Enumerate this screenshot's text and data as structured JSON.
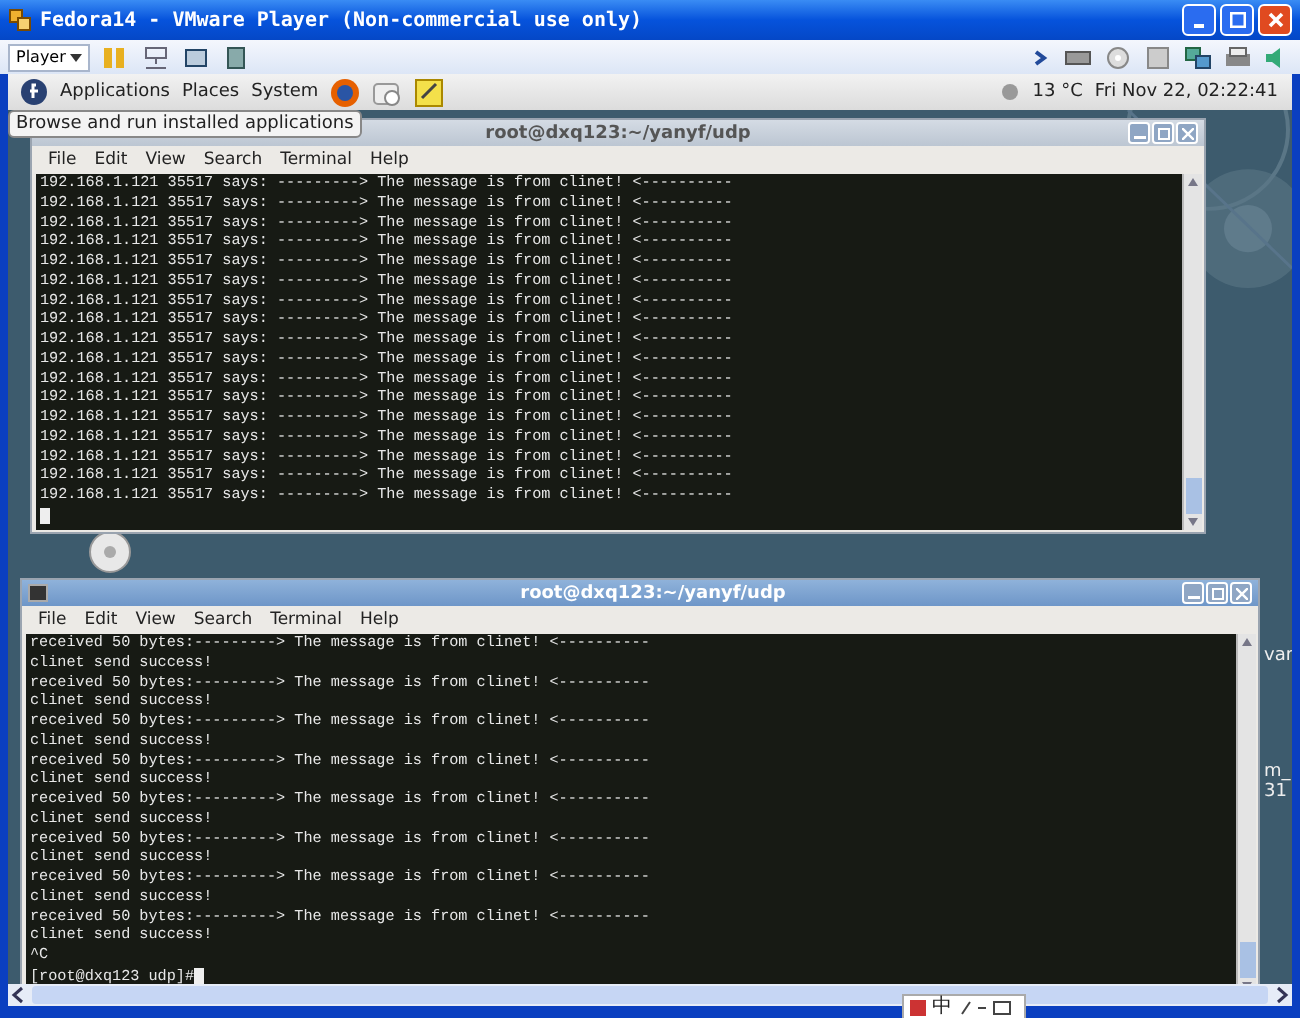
{
  "window": {
    "title": "Fedora14 - VMware Player (Non-commercial use only)"
  },
  "toolbar": {
    "player_label": "Player"
  },
  "panel": {
    "menus": [
      "Applications",
      "Places",
      "System"
    ],
    "weather": "13 °C",
    "clock": "Fri Nov 22, 02:22:41"
  },
  "tooltip": "Browse and run installed applications",
  "terminals": [
    {
      "title": "root@dxq123:~/yanyf/udp",
      "menus": [
        "File",
        "Edit",
        "View",
        "Search",
        "Terminal",
        "Help"
      ],
      "lines": [
        "192.168.1.121 35517 says: ---------> The message is from clinet! <----------",
        "192.168.1.121 35517 says: ---------> The message is from clinet! <----------",
        "192.168.1.121 35517 says: ---------> The message is from clinet! <----------",
        "192.168.1.121 35517 says: ---------> The message is from clinet! <----------",
        "192.168.1.121 35517 says: ---------> The message is from clinet! <----------",
        "192.168.1.121 35517 says: ---------> The message is from clinet! <----------",
        "192.168.1.121 35517 says: ---------> The message is from clinet! <----------",
        "192.168.1.121 35517 says: ---------> The message is from clinet! <----------",
        "192.168.1.121 35517 says: ---------> The message is from clinet! <----------",
        "192.168.1.121 35517 says: ---------> The message is from clinet! <----------",
        "192.168.1.121 35517 says: ---------> The message is from clinet! <----------",
        "192.168.1.121 35517 says: ---------> The message is from clinet! <----------",
        "192.168.1.121 35517 says: ---------> The message is from clinet! <----------",
        "192.168.1.121 35517 says: ---------> The message is from clinet! <----------",
        "192.168.1.121 35517 says: ---------> The message is from clinet! <----------",
        "192.168.1.121 35517 says: ---------> The message is from clinet! <----------",
        "192.168.1.121 35517 says: ---------> The message is from clinet! <----------"
      ]
    },
    {
      "title": "root@dxq123:~/yanyf/udp",
      "menus": [
        "File",
        "Edit",
        "View",
        "Search",
        "Terminal",
        "Help"
      ],
      "lines": [
        "received 50 bytes:---------> The message is from clinet! <----------",
        "clinet send success!",
        "received 50 bytes:---------> The message is from clinet! <----------",
        "clinet send success!",
        "received 50 bytes:---------> The message is from clinet! <----------",
        "clinet send success!",
        "received 50 bytes:---------> The message is from clinet! <----------",
        "clinet send success!",
        "received 50 bytes:---------> The message is from clinet! <----------",
        "clinet send success!",
        "received 50 bytes:---------> The message is from clinet! <----------",
        "clinet send success!",
        "received 50 bytes:---------> The message is from clinet! <----------",
        "clinet send success!",
        "received 50 bytes:---------> The message is from clinet! <----------",
        "clinet send success!",
        "^C"
      ],
      "prompt": "[root@dxq123 udp]#"
    }
  ],
  "desktop_labels": [
    "var",
    "m_",
    "31"
  ],
  "language_bar": {
    "label": "中"
  }
}
